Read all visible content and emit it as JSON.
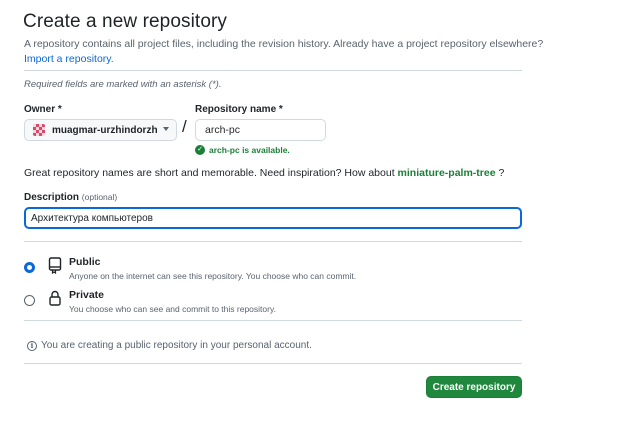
{
  "header": {
    "title": "Create a new repository",
    "subtitle": "A repository contains all project files, including the revision history. Already have a project repository elsewhere?",
    "import_link": "Import a repository.",
    "required_note": "Required fields are marked with an asterisk (*)."
  },
  "owner": {
    "label": "Owner *",
    "value": "muagmar-urzhindorzh"
  },
  "repository": {
    "label": "Repository name *",
    "value": "arch-pc",
    "availability": "arch-pc is available."
  },
  "suggestion": {
    "prefix": "Great repository names are short and memorable. Need inspiration? How about",
    "name": "miniature-palm-tree",
    "suffix": "?"
  },
  "description": {
    "label": "Description",
    "optional": "(optional)",
    "value": "Архитектура компьютеров"
  },
  "visibility": {
    "public": {
      "title": "Public",
      "description": "Anyone on the internet can see this repository. You choose who can commit.",
      "selected": true
    },
    "private": {
      "title": "Private",
      "description": "You choose who can see and commit to this repository.",
      "selected": false
    }
  },
  "info": {
    "text": "You are creating a public repository in your personal account."
  },
  "actions": {
    "create_label": "Create repository"
  },
  "colors": {
    "primary_button": "#1f883d",
    "link": "#0969da",
    "success": "#1a7f37"
  }
}
